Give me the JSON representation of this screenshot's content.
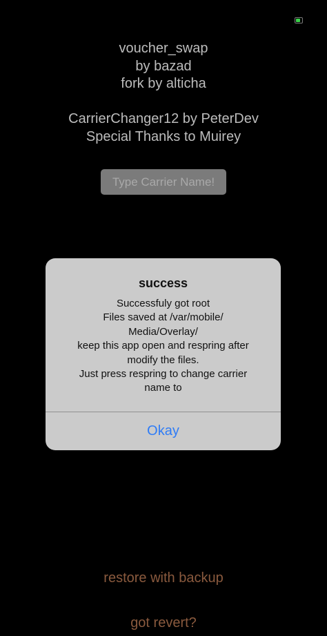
{
  "status_bar": {
    "battery_icon": "battery-charging-icon",
    "battery_color": "#3ad14a"
  },
  "credits": {
    "line1": "voucher_swap",
    "line2": "by bazad",
    "line3": "fork by alticha",
    "line4": "CarrierChanger12 by PeterDev",
    "line5": "Special Thanks to Muirey"
  },
  "carrier_input": {
    "value": "",
    "placeholder": "Type Carrier Name!"
  },
  "alert": {
    "title": "success",
    "message_lines": [
      "Successfuly got root",
      "Files saved at /var/mobile/",
      "Media/Overlay/",
      "keep this app open and respring after",
      "modify the files.",
      "Just press respring to change carrier",
      "name to"
    ],
    "okay_label": "Okay",
    "okay_color": "#2f7cf6"
  },
  "actions": {
    "restore_label": "restore with backup",
    "revert_label": "got revert?",
    "link_color": "#8a5a3e"
  }
}
